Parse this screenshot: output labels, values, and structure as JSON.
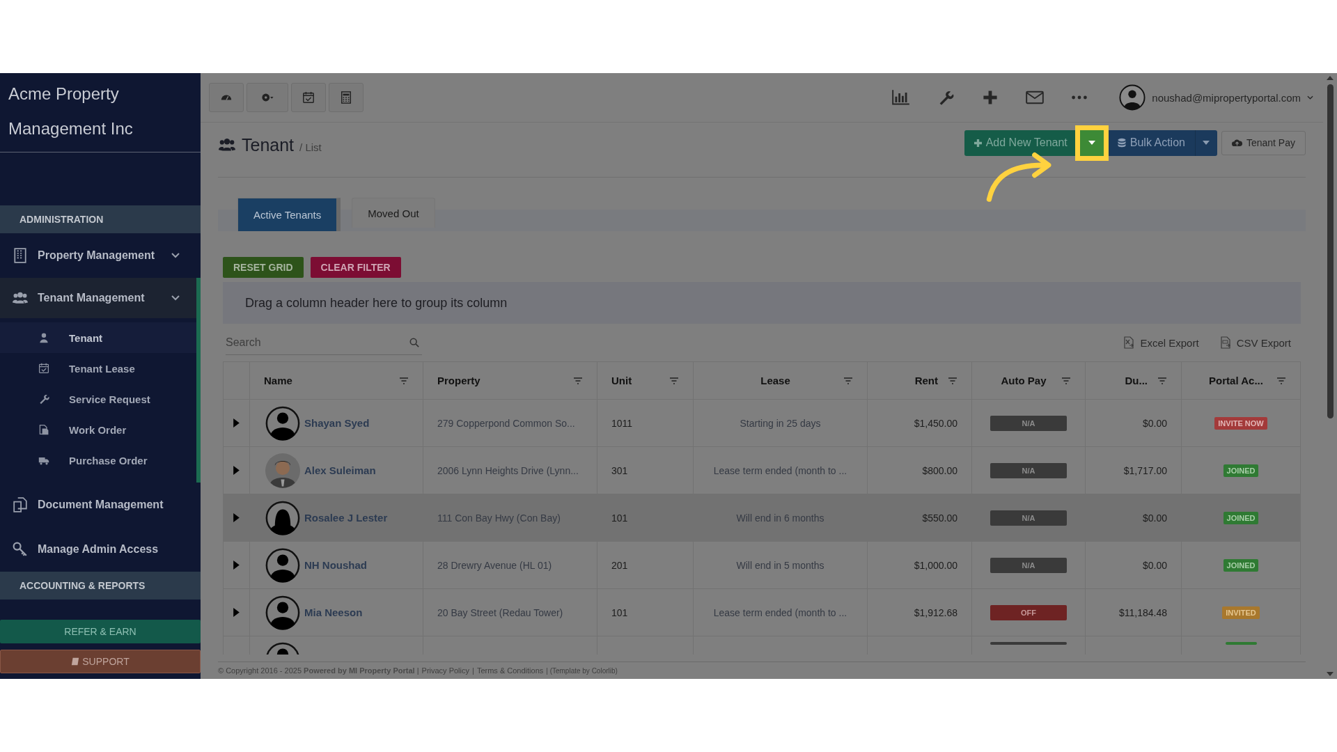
{
  "sidebar": {
    "title_lines": [
      "Acme Property",
      "Management Inc"
    ],
    "sections": [
      {
        "kind": "header",
        "label": "ADMINISTRATION"
      },
      {
        "kind": "item",
        "label": "Property Management",
        "selected": false
      },
      {
        "kind": "item",
        "label": "Tenant Management",
        "selected": true,
        "children": [
          {
            "label": "Tenant",
            "selected": true
          },
          {
            "label": "Tenant Lease",
            "selected": false
          },
          {
            "label": "Service Request",
            "selected": false
          },
          {
            "label": "Work Order",
            "selected": false
          },
          {
            "label": "Purchase Order",
            "selected": false
          }
        ]
      },
      {
        "kind": "link",
        "label": "Document Management",
        "selected": false
      },
      {
        "kind": "link",
        "label": "Manage Admin Access",
        "selected": false
      },
      {
        "kind": "header",
        "label": "ACCOUNTING & REPORTS"
      }
    ],
    "buttons": [
      {
        "kind": "refer",
        "label": "REFER & EARN"
      },
      {
        "kind": "support",
        "label": "SUPPORT"
      }
    ]
  },
  "user": {
    "email": "noushad@mipropertyportal.com"
  },
  "page": {
    "title": "Tenant",
    "breadcrumb": "/ List"
  },
  "actions": [
    {
      "kind": "add",
      "label": "Add New Tenant"
    },
    {
      "kind": "split",
      "highlighted": true
    },
    {
      "kind": "bulk",
      "label": "Bulk Action"
    },
    {
      "kind": "split",
      "highlighted": false
    },
    {
      "kind": "pay",
      "label": "Tenant Pay"
    }
  ],
  "tabs": [
    {
      "label": "Active Tenants",
      "selected": true
    },
    {
      "label": "Moved Out",
      "selected": false
    }
  ],
  "grid_buttons": [
    {
      "kind": "reset",
      "label": "RESET GRID"
    },
    {
      "kind": "clear",
      "label": "CLEAR FILTER"
    }
  ],
  "group_hint": "Drag a column header here to group its column",
  "search": {
    "placeholder": "Search"
  },
  "exports": [
    {
      "kind": "excel",
      "label": "Excel Export"
    },
    {
      "kind": "csv",
      "label": "CSV Export"
    }
  ],
  "table": {
    "columns": [
      {
        "label": "Name"
      },
      {
        "label": "Property"
      },
      {
        "label": "Unit"
      },
      {
        "label": "Lease"
      },
      {
        "label": "Rent"
      },
      {
        "label": "Auto Pay"
      },
      {
        "label": "Du..."
      },
      {
        "label": "Portal Ac..."
      }
    ],
    "rows": [
      {
        "name": "Shayan Syed",
        "property": "279 Copperpond Common So...",
        "unit": "1011",
        "lease": "Starting in 25 days",
        "rent": "$1,450.00",
        "autopay": {
          "kind": "na",
          "label": "N/A"
        },
        "due": "$0.00",
        "portal": {
          "kind": "invite",
          "label": "INVITE NOW"
        },
        "selected": false
      },
      {
        "name": "Alex Suleiman",
        "property": "2006 Lynn Heights Drive (Lynn...",
        "unit": "301",
        "lease": "Lease term ended (month to ...",
        "rent": "$800.00",
        "autopay": {
          "kind": "na",
          "label": "N/A"
        },
        "due": "$1,717.00",
        "portal": {
          "kind": "joined",
          "label": "JOINED"
        },
        "selected": false
      },
      {
        "name": "Rosalee J Lester",
        "property": "111 Con Bay Hwy (Con Bay)",
        "unit": "101",
        "lease": "Will end in 6 months",
        "rent": "$550.00",
        "autopay": {
          "kind": "na",
          "label": "N/A"
        },
        "due": "$0.00",
        "portal": {
          "kind": "joined",
          "label": "JOINED"
        },
        "selected": true
      },
      {
        "name": "NH Noushad",
        "property": "28 Drewry Avenue (HL 01)",
        "unit": "201",
        "lease": "Will end in 5 months",
        "rent": "$1,000.00",
        "autopay": {
          "kind": "na",
          "label": "N/A"
        },
        "due": "$0.00",
        "portal": {
          "kind": "joined",
          "label": "JOINED"
        },
        "selected": false
      },
      {
        "name": "Mia Neeson",
        "property": "20 Bay Street (Redau Tower)",
        "unit": "101",
        "lease": "Lease term ended (month to ...",
        "rent": "$1,912.68",
        "autopay": {
          "kind": "off",
          "label": "OFF"
        },
        "due": "$11,184.48",
        "portal": {
          "kind": "invited",
          "label": "INVITED"
        },
        "selected": false
      }
    ],
    "partial_row": {
      "autopay": {
        "kind": "na"
      },
      "portal": {
        "kind": "joined"
      }
    }
  },
  "footer": [
    {
      "kind": "text",
      "text": "© Copyright 2016 - 2025 **Powered by MI Property Portal** |"
    },
    {
      "kind": "link",
      "text": "Privacy Policy"
    },
    {
      "kind": "text",
      "text": "|"
    },
    {
      "kind": "link",
      "text": "Terms & Conditions"
    },
    {
      "kind": "note",
      "text": "| (Template by Colorlib)"
    }
  ]
}
